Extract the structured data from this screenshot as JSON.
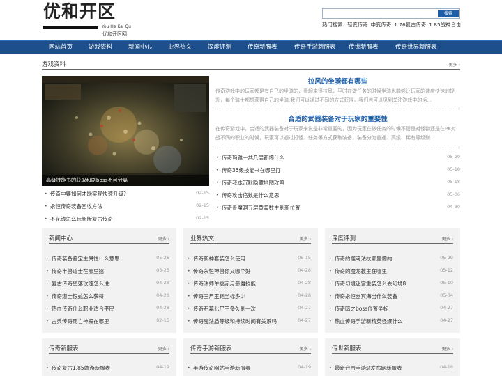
{
  "logo": {
    "mark": "优和开区",
    "pinyin": "You He Kai Qu",
    "sub": "优和开区网"
  },
  "search": {
    "value": "",
    "button": "搜索"
  },
  "hot": {
    "label": "热门搜索:",
    "terms": [
      "轻变传奇",
      "中变传奇",
      "1.76复古传奇",
      "1.85战神合击"
    ]
  },
  "nav": [
    "网站首页",
    "游戏资料",
    "新闻中心",
    "业界热文",
    "深度评测",
    "传奇新服表",
    "传奇手游新服表",
    "传世新服表",
    "传奇世界新服表"
  ],
  "main": {
    "title": "游戏资料",
    "more": "更多",
    "hero_caption": "高级技能书的获取和刷boss不可分离",
    "left_list": [
      {
        "text": "传奇中要如何才能实现快速升级?",
        "date": "02-15"
      },
      {
        "text": "永恒传奇装备回收方法",
        "date": "02-15"
      },
      {
        "text": "不花钱怎么玩新版复古传奇",
        "date": "02-15"
      }
    ],
    "articles": [
      {
        "title": "拉风的坐骑都有哪些",
        "summary": "传奇游戏中的玩家都是有自己的坐骑的，看起来很拉风，平时在做任务的时候坐骑也能够让玩家的速度快速的提升，每个骑士都想获得自己的坐骑,我们可以通过不同的方式获得，我们也可以见到关注游戏中的活..."
      },
      {
        "title": "合适的武器装备对于玩家的重要性",
        "summary": "在传奇游戏中，合适的武器装备对于玩家来说是非常重要的，因为玩家在做任务的时候不管是对怪物还是在PK对战不同的职业的时候，玩家可以通过打怪、任务等方式获取装备，装备分为普通、高级、稀有等级别..."
      }
    ],
    "right_list": [
      {
        "text": "传奇玛雅一共几层都爆什么",
        "date": "05-29"
      },
      {
        "text": "传奇35级技能书在哪里打",
        "date": "05-18"
      },
      {
        "text": "传奇我本沉默隐藏地图攻略",
        "date": "05-18"
      },
      {
        "text": "传奇攻击倍数是什么意思",
        "date": "05-06"
      },
      {
        "text": "传奇骨魔洞五层黄装数主刷新位置",
        "date": "04-30"
      }
    ]
  },
  "panels": [
    {
      "title": "新闻中心",
      "more": "更多",
      "items": [
        {
          "text": "传奇装备鉴定主属性什么意思",
          "date": "05-26"
        },
        {
          "text": "传奇半兽道士在哪里招",
          "date": "05-25"
        },
        {
          "text": "复古传奇堡落玫瑰怎么进",
          "date": "04-28"
        },
        {
          "text": "传奇道士银蛇怎么获得",
          "date": "04-28"
        },
        {
          "text": "热血传奇什么职业适合平民",
          "date": "04-28"
        },
        {
          "text": "古典传奇死亡神殿在哪里",
          "date": "02-15"
        }
      ]
    },
    {
      "title": "业界热文",
      "more": "更多",
      "items": [
        {
          "text": "传奇新神套装怎么使用",
          "date": "05-15"
        },
        {
          "text": "传奇永恒神兽你又哪个好",
          "date": "04-28"
        },
        {
          "text": "传奇法师单挑赤月恶魔技能",
          "date": "04-28"
        },
        {
          "text": "传奇三尸王跑坐标多少",
          "date": "04-28"
        },
        {
          "text": "传奇石墓七尸王多久刷一次",
          "date": "04-27"
        },
        {
          "text": "传奇魔法盾等级和持续时间有关系吗",
          "date": "04-27"
        }
      ]
    },
    {
      "title": "深度评测",
      "more": "更多",
      "items": [
        {
          "text": "传奇的噬魂法杖哪里爆的",
          "date": "05-29"
        },
        {
          "text": "传奇的魔龙教主在哪里",
          "date": "05-12"
        },
        {
          "text": "传奇幻境迷宫重装怎么去幻境8",
          "date": "05-10"
        },
        {
          "text": "传奇永恒幽冥海出什么装备",
          "date": "05-04"
        },
        {
          "text": "传奇暗之boss位置坐标",
          "date": "04-27"
        },
        {
          "text": "热血传奇手游新精英怪爆什么",
          "date": "04-27"
        }
      ]
    },
    {
      "title": "传奇新服表",
      "more": "更多",
      "items": [
        {
          "text": "传奇复古1.85端游新服表",
          "date": "04-19"
        }
      ]
    },
    {
      "title": "传奇手游新服表",
      "more": "更多",
      "items": [
        {
          "text": "手游传奇网站手游新服表",
          "date": "04-19"
        }
      ]
    },
    {
      "title": "传世新服表",
      "more": "更多",
      "items": [
        {
          "text": "最新合击手游sf发布网新服表",
          "date": "04-18"
        }
      ]
    }
  ]
}
